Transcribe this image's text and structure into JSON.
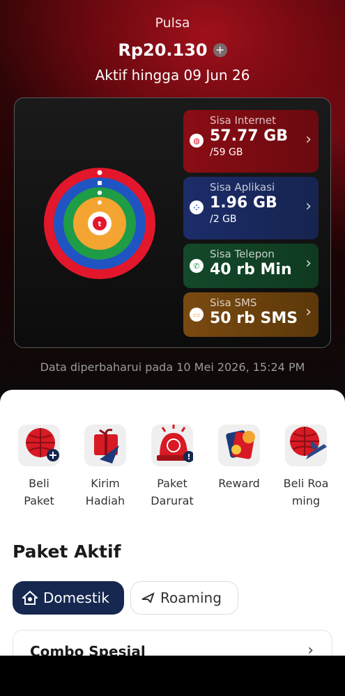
{
  "header": {
    "label": "Pulsa",
    "balance": "Rp20.130",
    "add_icon": "plus-icon",
    "active_until": "Aktif hingga 09 Jun 26"
  },
  "quota": {
    "donut_colors": [
      "#e3172c",
      "#1f54c2",
      "#1e9c46",
      "#f4a531"
    ],
    "tiles": [
      {
        "label": "Sisa Internet",
        "value": "57.77 GB",
        "total": "/59 GB",
        "icon": "globe-icon",
        "color": "#e3172c"
      },
      {
        "label": "Sisa Aplikasi",
        "value": "1.96 GB",
        "total": "/2 GB",
        "icon": "apps-grid-icon",
        "color": "#1f54c2"
      },
      {
        "label": "Sisa Telepon",
        "value": "40 rb Min",
        "icon": "phone-icon",
        "color": "#1e9c46"
      },
      {
        "label": "Sisa SMS",
        "value": "50 rb SMS",
        "icon": "message-icon",
        "color": "#f4a531"
      }
    ]
  },
  "updated_text": "Data diperbaharui pada 10 Mei 2026, 15:24 PM",
  "menu": [
    {
      "label_line1": "Beli",
      "label_line2": "Paket",
      "icon": "buy-package-icon"
    },
    {
      "label_line1": "Kirim",
      "label_line2": "Hadiah",
      "icon": "gift-send-icon"
    },
    {
      "label_line1": "Paket",
      "label_line2": "Darurat",
      "icon": "emergency-package-icon"
    },
    {
      "label_line1": "Reward",
      "label_line2": "",
      "icon": "reward-icon"
    },
    {
      "label_line1": "Beli Roa",
      "label_line2": "ming",
      "icon": "buy-roaming-icon"
    }
  ],
  "active_packages": {
    "title": "Paket Aktif",
    "tabs": [
      {
        "label": "Domestik",
        "icon": "home-icon",
        "selected": true
      },
      {
        "label": "Roaming",
        "icon": "plane-icon",
        "selected": false
      }
    ],
    "first_package": "Combo Spesial"
  }
}
